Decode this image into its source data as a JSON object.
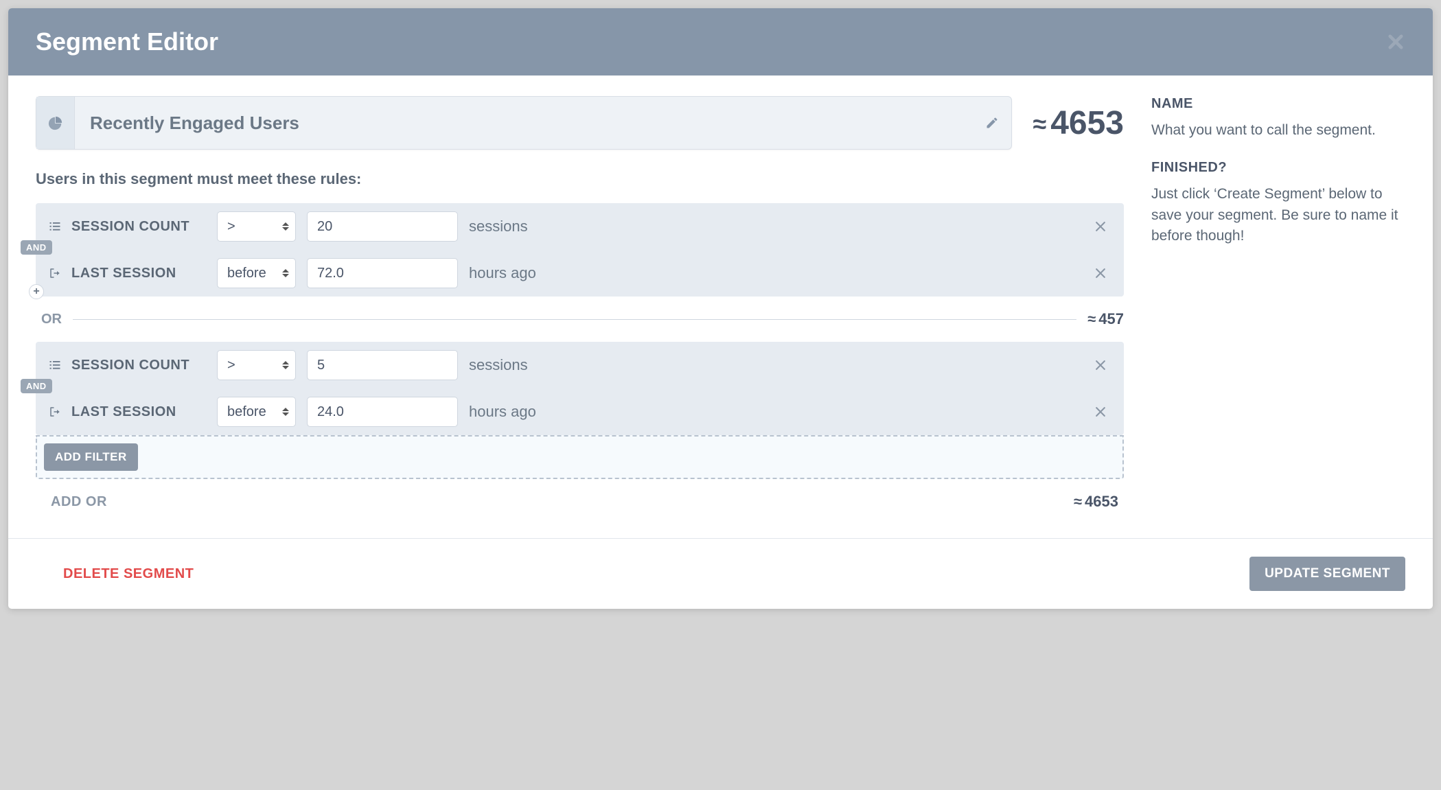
{
  "header": {
    "title": "Segment Editor"
  },
  "segment": {
    "name": "Recently Engaged Users",
    "total_count": "4653"
  },
  "rules_intro": "Users in this segment must meet these rules:",
  "groups": [
    {
      "and_label": "AND",
      "rules": [
        {
          "label": "SESSION COUNT",
          "op": ">",
          "value": "20",
          "unit": "sessions"
        },
        {
          "label": "LAST SESSION",
          "op": "before",
          "value": "72.0",
          "unit": "hours ago"
        }
      ]
    },
    {
      "and_label": "AND",
      "rules": [
        {
          "label": "SESSION COUNT",
          "op": ">",
          "value": "5",
          "unit": "sessions"
        },
        {
          "label": "LAST SESSION",
          "op": "before",
          "value": "24.0",
          "unit": "hours ago"
        }
      ]
    }
  ],
  "or_sep": {
    "label": "OR",
    "count": "457"
  },
  "add_filter_label": "ADD FILTER",
  "add_or": {
    "label": "ADD OR",
    "count": "4653"
  },
  "sidebar": {
    "name_heading": "NAME",
    "name_desc": "What you want to call the segment.",
    "finished_heading": "FINISHED?",
    "finished_desc": "Just click ‘Create Segment’ below to save your segment. Be sure to name it before though!"
  },
  "footer": {
    "delete_label": "DELETE SEGMENT",
    "update_label": "UPDATE SEGMENT"
  }
}
